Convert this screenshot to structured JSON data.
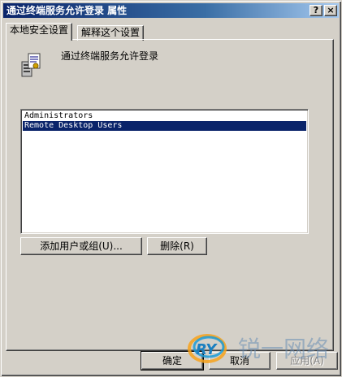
{
  "window": {
    "title": "通过终端服务允许登录 属性",
    "help_glyph": "?",
    "close_glyph": "×"
  },
  "tabs": [
    {
      "label": "本地安全设置",
      "active": true
    },
    {
      "label": "解释这个设置",
      "active": false
    }
  ],
  "policy": {
    "name": "通过终端服务允许登录",
    "icon": "policy-server-icon"
  },
  "list": {
    "items": [
      {
        "label": "Administrators",
        "selected": false
      },
      {
        "label": "Remote Desktop Users",
        "selected": true
      }
    ]
  },
  "buttons": {
    "add": "添加用户或组(U)...",
    "remove": "删除(R)",
    "ok": "确定",
    "cancel": "取消",
    "apply": "应用(A)"
  },
  "watermark": {
    "logo_text": "RY",
    "chars": "锐一网络"
  },
  "colors": {
    "titlebar_start": "#0a246a",
    "titlebar_end": "#a6caf0",
    "selection": "#0a246a",
    "face": "#d4d0c8"
  }
}
